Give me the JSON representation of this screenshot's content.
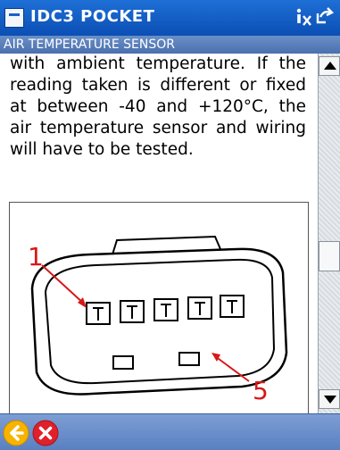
{
  "window": {
    "title": "IDC3 POCKET",
    "icons": [
      "info-tool-icon",
      "exit-icon"
    ]
  },
  "section": {
    "title": "AIR TEMPERATURE SENSOR"
  },
  "content": {
    "text": "with ambient temperature. If the reading taken is different or fixed at between -40 and +120°C, the air temperature sensor and wiring will have to be tested.",
    "figure": {
      "callout_1": "1",
      "callout_5": "5"
    }
  },
  "bottom_bar": {
    "buttons": [
      "back-arrow-icon",
      "close-icon"
    ],
    "colors": {
      "back": "#f6b300",
      "close": "#e0202a"
    }
  }
}
